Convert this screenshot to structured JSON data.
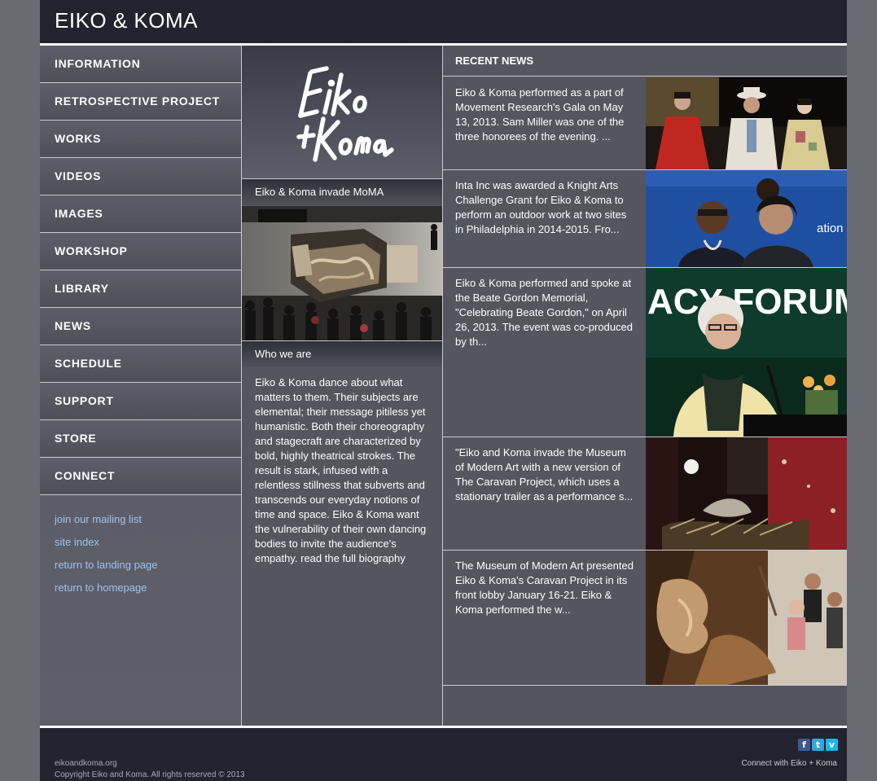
{
  "site": {
    "title": "EIKO & KOMA"
  },
  "nav": {
    "items": [
      {
        "label": "INFORMATION"
      },
      {
        "label": "RETROSPECTIVE PROJECT"
      },
      {
        "label": "WORKS"
      },
      {
        "label": "VIDEOS"
      },
      {
        "label": "IMAGES"
      },
      {
        "label": "WORKSHOP"
      },
      {
        "label": "LIBRARY"
      },
      {
        "label": "NEWS"
      },
      {
        "label": "SCHEDULE"
      },
      {
        "label": "SUPPORT"
      },
      {
        "label": "STORE"
      },
      {
        "label": "CONNECT"
      }
    ],
    "links": [
      {
        "label": "join our mailing list"
      },
      {
        "label": "site index"
      },
      {
        "label": "return to landing page"
      },
      {
        "label": "return to homepage"
      }
    ]
  },
  "middle": {
    "logo_text": "Eiko + Koma",
    "moma_heading": "Eiko & Koma invade MoMA",
    "who_heading": "Who we are",
    "who_text": "Eiko & Koma dance about what matters to them. Their subjects are elemental; their message pitiless yet humanistic. Both their choreography and stagecraft are characterized by bold, highly theatrical strokes. The result is stark, infused with a relentless stillness that subverts and transcends our everyday notions of time and space.  Eiko & Koma want the vulnerability of their own dancing bodies to invite the audience's empathy.",
    "bio_link": "read the full biography"
  },
  "news": {
    "heading": "RECENT NEWS",
    "items": [
      {
        "text": "Eiko & Koma performed as a part of Movement Research's Gala on May 13, 2013. Sam Miller was one of the three honorees of the evening.  ..."
      },
      {
        "text": "Inta Inc was awarded a Knight Arts Challenge Grant for Eiko & Koma to perform an outdoor work at two sites in Philadelphia in 2014-2015. Fro..."
      },
      {
        "text": "Eiko & Koma performed and spoke at the Beate Gordon Memorial, \"Celebrating Beate Gordon,\" on April 26, 2013. The event was co-produced by th..."
      },
      {
        "text": "\"Eiko and Koma invade the Museum of Modern Art with a new version of The Caravan Project, which uses a stationary trailer as a performance s..."
      },
      {
        "text": "The Museum of Modern Art presented Eiko & Koma's  Caravan Project in its front lobby January 16-21. Eiko & Koma performed the w..."
      }
    ],
    "photo2_sign": "ation",
    "photo3_sign": "ACY FORUM"
  },
  "footer": {
    "domain": "eikoandkoma.org",
    "copyright": "Copyright Eiko and Koma. All rights reserved © 2013",
    "connect": "Connect with Eiko + Koma",
    "social": [
      {
        "icon": "facebook-icon",
        "glyph": "f",
        "color": "#3b5998"
      },
      {
        "icon": "twitter-icon",
        "glyph": "t",
        "color": "#33a7d8"
      },
      {
        "icon": "vimeo-icon",
        "glyph": "v",
        "color": "#1ab7ea"
      }
    ]
  },
  "colors": {
    "header_bg": "#23232f",
    "panel_bg": "#54555f",
    "link": "#9fc3ee",
    "divider": "#c9c9cf"
  }
}
